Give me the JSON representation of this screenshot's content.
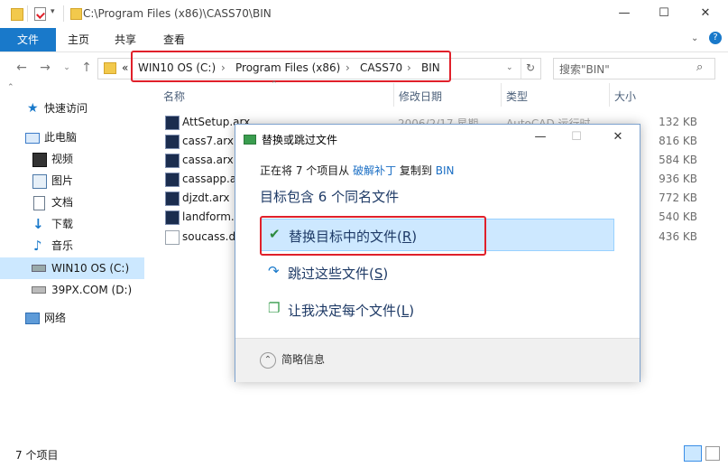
{
  "window": {
    "title": "C:\\Program Files (x86)\\CASS70\\BIN",
    "minimize": "—",
    "maximize": "☐",
    "close": "✕",
    "help": "?"
  },
  "ribbon": {
    "tabs": [
      "文件",
      "主页",
      "共享",
      "查看"
    ]
  },
  "address": {
    "prefix": "«",
    "crumbs": [
      "WIN10 OS (C:)",
      "Program Files (x86)",
      "CASS70",
      "BIN"
    ],
    "separator": "›",
    "search_placeholder": "搜索\"BIN\""
  },
  "sidebar": {
    "items": [
      {
        "label": "快速访问",
        "icon": "star-icon"
      },
      {
        "label": "此电脑",
        "icon": "computer-icon"
      },
      {
        "label": "视频",
        "icon": "video-icon"
      },
      {
        "label": "图片",
        "icon": "picture-icon"
      },
      {
        "label": "文档",
        "icon": "document-icon"
      },
      {
        "label": "下载",
        "icon": "download-icon"
      },
      {
        "label": "音乐",
        "icon": "music-icon"
      },
      {
        "label": "WIN10 OS (C:)",
        "icon": "drive-icon"
      },
      {
        "label": "39PX.COM (D:)",
        "icon": "drive-icon"
      },
      {
        "label": "网络",
        "icon": "network-icon"
      }
    ]
  },
  "columns": {
    "name": "名称",
    "date": "修改日期",
    "type": "类型",
    "size": "大小"
  },
  "files": [
    {
      "name": "AttSetup.arx",
      "date": "2006/2/17 星期...",
      "type": "AutoCAD 运行时...",
      "size": "132 KB"
    },
    {
      "name": "cass7.arx",
      "date": "",
      "type": "",
      "size": "816 KB"
    },
    {
      "name": "cassa.arx",
      "date": "",
      "type": "",
      "size": "584 KB"
    },
    {
      "name": "cassapp.arx",
      "date": "",
      "type": "",
      "size": "936 KB"
    },
    {
      "name": "djzdt.arx",
      "date": "",
      "type": "",
      "size": "772 KB"
    },
    {
      "name": "landform.arx",
      "date": "",
      "type": "",
      "size": "540 KB"
    },
    {
      "name": "soucass.dll",
      "date": "",
      "type": "",
      "size": "436 KB"
    }
  ],
  "status": {
    "count": "7 个项目"
  },
  "dialog": {
    "title": "替换或跳过文件",
    "line1_a": "正在将 7 个项目从 ",
    "line1_src": "破解补丁",
    "line1_b": " 复制到 ",
    "line1_dst": "BIN",
    "heading": "目标包含 6 个同名文件",
    "options": [
      {
        "label": "替换目标中的文件(",
        "key": "R",
        "end": ")",
        "icon": "✔"
      },
      {
        "label": "跳过这些文件(",
        "key": "S",
        "end": ")",
        "icon": "↷"
      },
      {
        "label": "让我决定每个文件(",
        "key": "L",
        "end": ")",
        "icon": "❐"
      }
    ],
    "details": "简略信息",
    "details_icon": "⌃"
  },
  "colors": {
    "accent": "#1979ca",
    "highlight": "#cde8ff",
    "annotation": "#e0202a"
  }
}
